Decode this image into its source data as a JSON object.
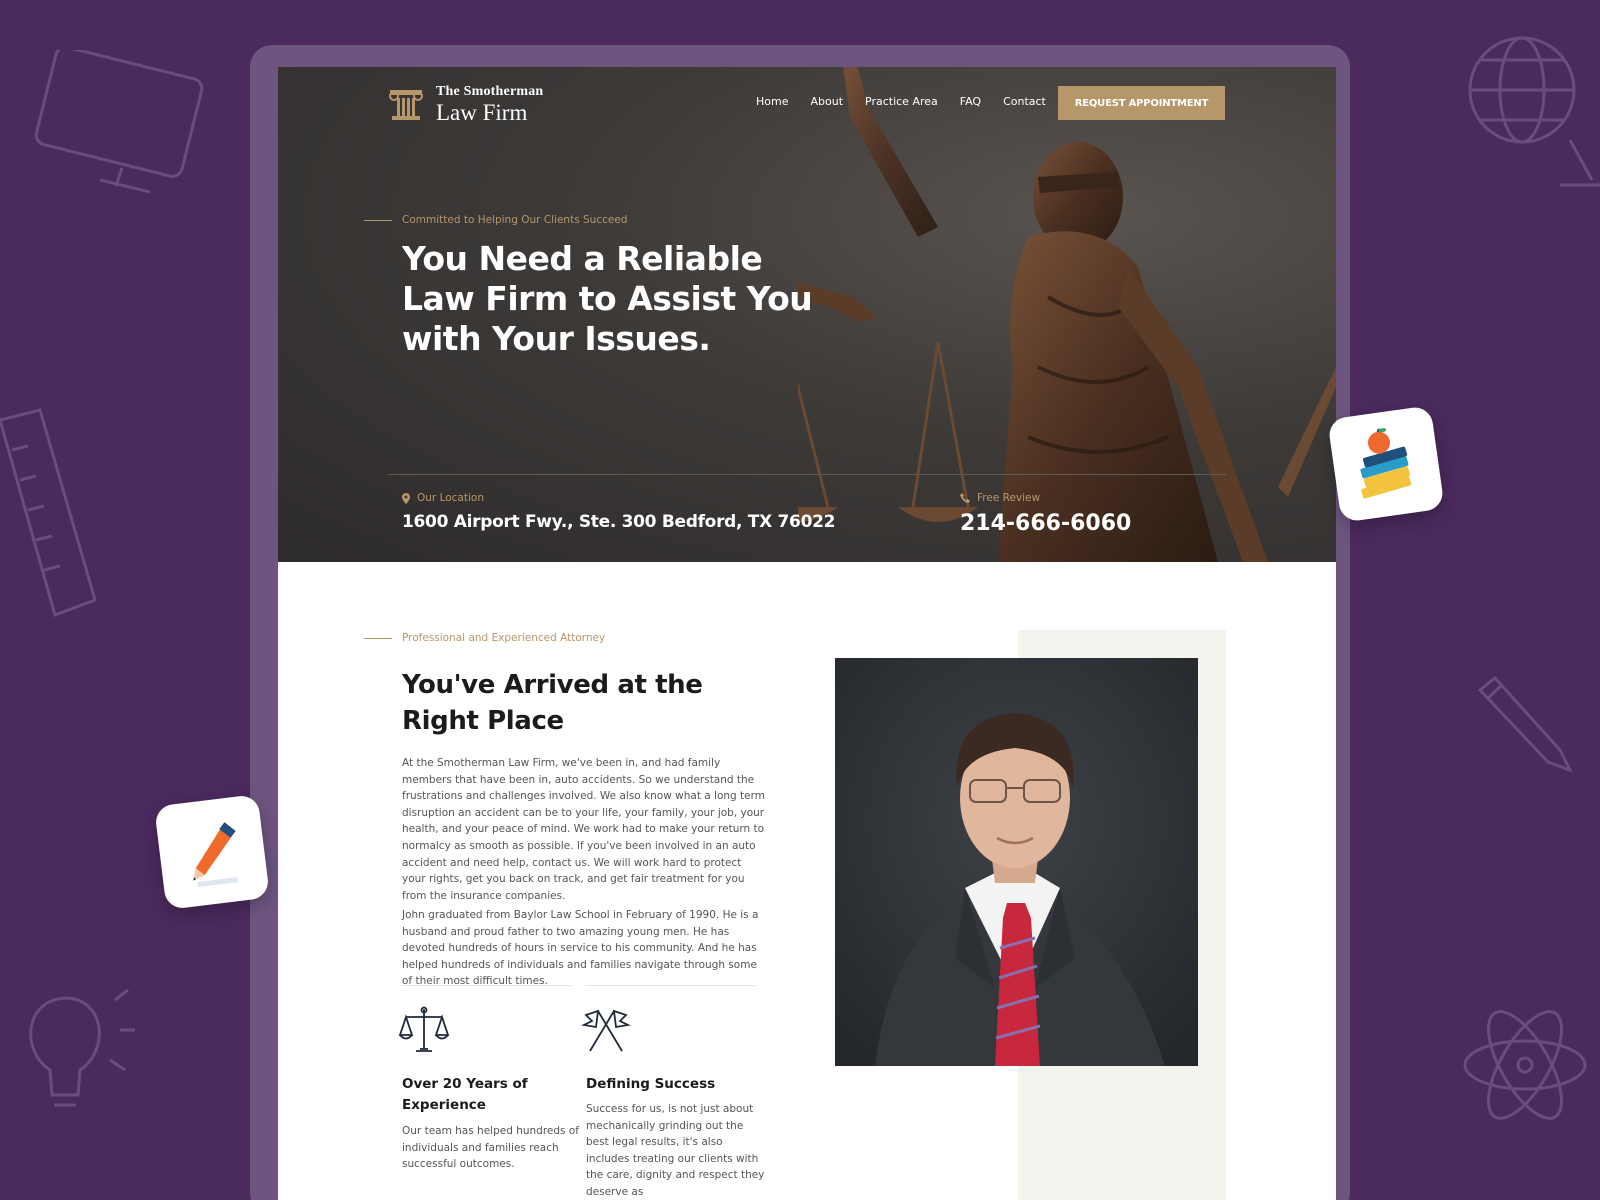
{
  "brand": {
    "line1": "The Smotherman",
    "line2": "Law Firm"
  },
  "nav": {
    "items": [
      {
        "label": "Home"
      },
      {
        "label": "About"
      },
      {
        "label": "Practice Area"
      },
      {
        "label": "FAQ"
      },
      {
        "label": "Contact"
      }
    ],
    "cta_label": "REQUEST APPOINTMENT"
  },
  "hero": {
    "eyebrow": "Committed to Helping Our Clients Succeed",
    "title": "You Need a Reliable Law Firm to Assist You with Your Issues.",
    "location_label": "Our Location",
    "location_value": "1600 Airport Fwy., Ste. 300 Bedford, TX 76022",
    "review_label": "Free Review",
    "phone": "214-666-6060"
  },
  "about": {
    "eyebrow": "Professional and Experienced Attorney",
    "title": "You've Arrived at the Right Place",
    "paragraph1": "At the Smotherman Law Firm, we've been in, and had family members that have been in, auto accidents. So we understand the frustrations and challenges involved. We also know what a long term disruption an accident can be to your life, your family, your job, your health, and your peace of mind. We work had to make your return to normalcy as smooth as possible. If you've been involved in an auto accident and need help, contact us. We will work hard to protect your rights, get you back on track, and get fair treatment for you from the insurance companies.",
    "paragraph2": "John graduated from Baylor Law School in February of 1990.  He is a husband and proud father to two amazing young men.  He has devoted hundreds of hours in service to his community.  And he has helped hundreds of individuals and families navigate through some of their most difficult times.",
    "features": [
      {
        "icon": "scales-icon",
        "title": "Over 20 Years of Experience",
        "text": "Our team has helped hundreds of individuals and families reach successful outcomes."
      },
      {
        "icon": "crossed-flags-icon",
        "title": "Defining Success",
        "text": "Success for us, is not just about mechanically grinding out the best legal results, it's also includes treating our clients with the care, dignity and respect they deserve as"
      }
    ]
  },
  "colors": {
    "background": "#4b2a5e",
    "accent": "#b5976a",
    "hero_dark": "#3d3a38"
  }
}
